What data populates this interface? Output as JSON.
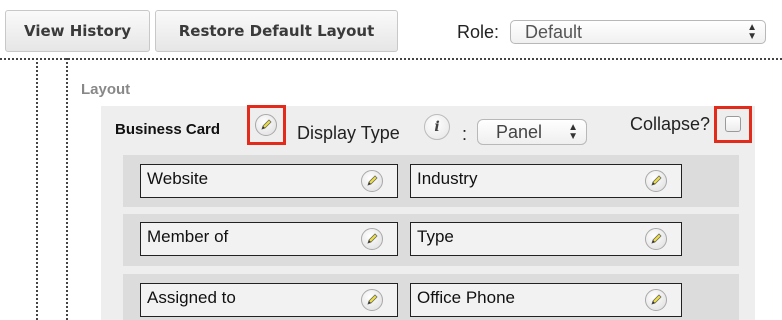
{
  "toolbar": {
    "view_history": "View History",
    "restore_default_layout": "Restore Default Layout",
    "role_label": "Role:",
    "role_value": "Default"
  },
  "layout": {
    "heading": "Layout",
    "panel": {
      "name": "Business Card",
      "display_type_label": "Display Type",
      "info_icon": "i",
      "colon": ":",
      "display_type_value": "Panel",
      "collapse_label": "Collapse?",
      "collapse_checked": false
    },
    "rows": [
      {
        "left": "Website",
        "right": "Industry"
      },
      {
        "left": "Member of",
        "right": "Type"
      },
      {
        "left": "Assigned to",
        "right": "Office Phone"
      }
    ]
  },
  "colors": {
    "highlight": "#e22b1a",
    "panel_background": "#eeeeee",
    "row_background": "#dcdcdc"
  }
}
